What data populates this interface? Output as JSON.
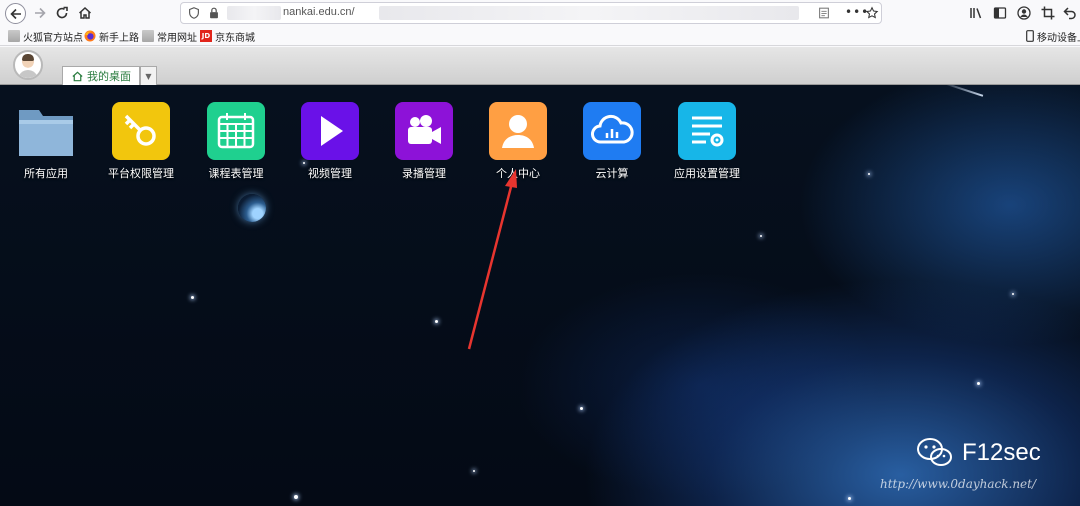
{
  "browser": {
    "url_visible": "nankai.edu.cn/",
    "buttons": {
      "back": "back-arrow-icon",
      "forward": "forward-arrow-icon",
      "reload": "reload-icon",
      "home": "home-icon",
      "more": "•••",
      "bookmark_star": "star-icon",
      "library": "library-icon",
      "sidebar": "sidebar-icon",
      "account": "account-icon",
      "screenshot": "crop-icon",
      "undo": "undo-icon"
    }
  },
  "bookmarks": {
    "items": [
      {
        "label": "火狐官方站点",
        "icon": "folder-icon"
      },
      {
        "label": "新手上路",
        "icon": "firefox-icon"
      },
      {
        "label": "常用网址",
        "icon": "folder-icon"
      },
      {
        "label": "京东商城",
        "icon": "jd-icon"
      }
    ],
    "mobile": "移动设备上"
  },
  "header": {
    "tab_label": "我的桌面",
    "tab_more": "▼"
  },
  "desktop": {
    "apps": [
      {
        "label": "所有应用",
        "icon": "folder-icon",
        "color": "#7da8cf"
      },
      {
        "label": "平台权限管理",
        "icon": "key-icon",
        "color": "#f2c60d"
      },
      {
        "label": "课程表管理",
        "icon": "calendar-icon",
        "color": "#1fd08f"
      },
      {
        "label": "视频管理",
        "icon": "play-icon",
        "color": "#6a11e8"
      },
      {
        "label": "录播管理",
        "icon": "video-camera-icon",
        "color": "#8d12d8"
      },
      {
        "label": "个人中心",
        "icon": "user-icon",
        "color": "#ff9f43"
      },
      {
        "label": "云计算",
        "icon": "cloud-icon",
        "color": "#1f7cf2"
      },
      {
        "label": "应用设置管理",
        "icon": "settings-list-icon",
        "color": "#17b6e8"
      }
    ]
  },
  "watermark": {
    "brand": "F12sec",
    "url": "http://www.0dayhack.net/"
  },
  "colors": {
    "annotation_arrow": "#e8352f",
    "tab_text": "#2a7c3f"
  }
}
